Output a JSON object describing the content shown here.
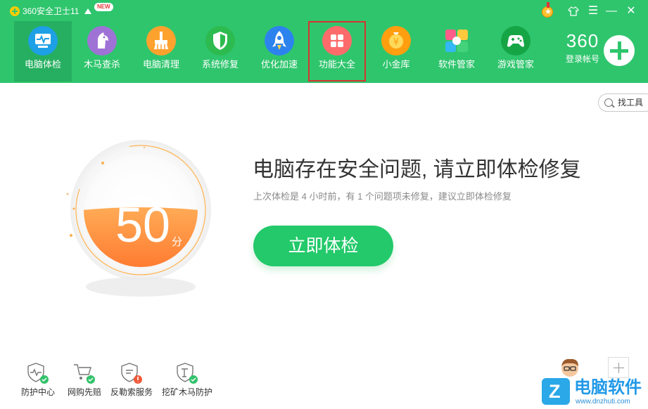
{
  "app": {
    "title": "360安全卫士11",
    "new_badge": "NEW"
  },
  "window_controls": {
    "medal": "medal-icon",
    "skin": "shirt-icon",
    "menu": "menu-icon",
    "minimize": "minimize-icon",
    "close": "close-icon"
  },
  "nav": {
    "items": [
      {
        "label": "电脑体检",
        "icon": "monitor-check-icon",
        "color": "#1ea0e6",
        "active": true
      },
      {
        "label": "木马查杀",
        "icon": "horse-icon",
        "color": "#9f72d6"
      },
      {
        "label": "电脑清理",
        "icon": "broom-icon",
        "color": "#ffa22d"
      },
      {
        "label": "系统修复",
        "icon": "shield-icon",
        "color": "#2dbb4f"
      },
      {
        "label": "优化加速",
        "icon": "rocket-icon",
        "color": "#2d83ed"
      },
      {
        "label": "功能大全",
        "icon": "grid-icon",
        "color": "#ff6b6b",
        "highlighted": true
      },
      {
        "label": "小金库",
        "icon": "coin-icon",
        "color": "#ff9f0f"
      },
      {
        "label": "软件管家",
        "icon": "apps-icon",
        "color": "#ffffff"
      },
      {
        "label": "游戏管家",
        "icon": "gamepad-icon",
        "color": "#16a545"
      }
    ]
  },
  "account": {
    "brand": "360",
    "label": "登录帐号"
  },
  "tool_search": {
    "label": "找工具"
  },
  "score": {
    "value": "50",
    "unit": "分",
    "fill_fraction": 0.5
  },
  "main": {
    "headline": "电脑存在安全问题, 请立即体检修复",
    "subtext": "上次体检是 4 小时前，有 1 个问题项未修复，建议立即体检修复",
    "button": "立即体检"
  },
  "shortcuts": [
    {
      "label": "防护中心",
      "icon": "shield-pulse-icon",
      "status": "ok"
    },
    {
      "label": "网购先赔",
      "icon": "cart-check-icon",
      "status": "ok"
    },
    {
      "label": "反勒索服务",
      "icon": "lock-alert-icon",
      "status": "warning"
    },
    {
      "label": "挖矿木马防护",
      "icon": "mining-shield-icon",
      "status": "ok"
    }
  ],
  "watermark": {
    "logo": "Z",
    "text": "电脑软件",
    "url": "www.dnzhuti.com"
  }
}
